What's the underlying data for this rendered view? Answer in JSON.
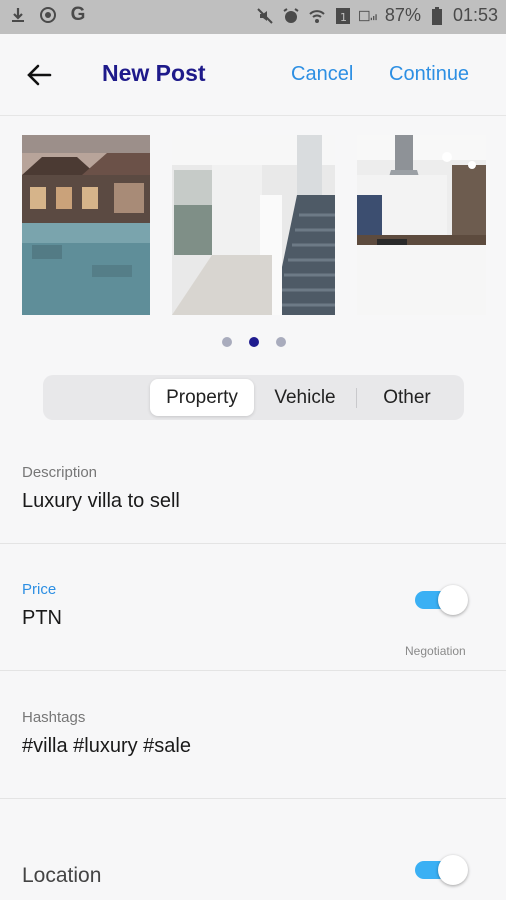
{
  "status_bar": {
    "battery": "87%",
    "time": "01:53",
    "icons_left": [
      "download-icon",
      "sync-icon",
      "google-icon"
    ],
    "icons_right": [
      "mute-icon",
      "alarm-icon",
      "wifi-icon",
      "sim-icon",
      "signal-icon",
      "battery-icon"
    ]
  },
  "app_bar": {
    "title": "New Post",
    "cancel_label": "Cancel",
    "continue_label": "Continue"
  },
  "gallery": {
    "images": [
      "pool-villa-image",
      "staircase-interior-image",
      "kitchen-interior-image"
    ],
    "active_index": 1,
    "page_count": 3
  },
  "segments": {
    "items": [
      "Property",
      "Vehicle",
      "Other"
    ],
    "selected": "Property"
  },
  "form": {
    "description": {
      "label": "Description",
      "value": "Luxury villa to sell"
    },
    "price": {
      "label": "Price",
      "value": "PTN",
      "toggle_note": "Negotiation",
      "toggle_on": true
    },
    "hashtags": {
      "label": "Hashtags",
      "value": "#villa #luxury #sale"
    },
    "location": {
      "label": "Location",
      "toggle_on": true
    }
  },
  "colors": {
    "accent": "#2d8fe3",
    "title": "#1e1a8a",
    "toggle": "#3ab0f4"
  }
}
